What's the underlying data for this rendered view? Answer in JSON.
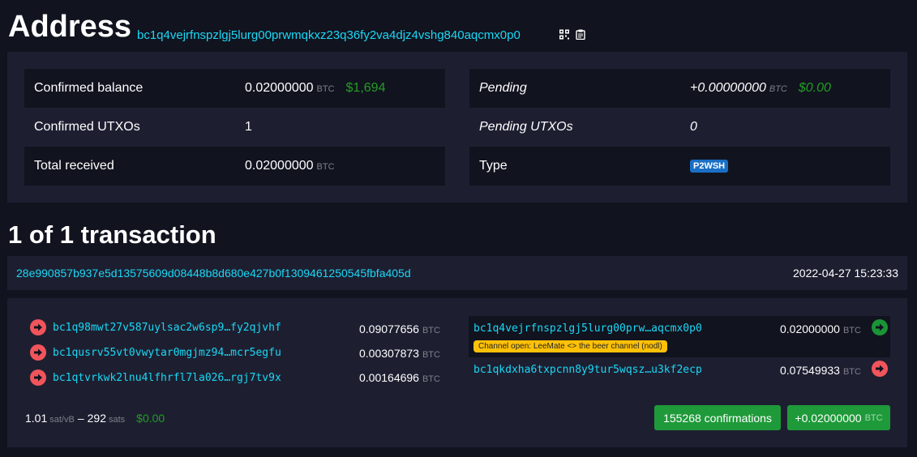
{
  "page": {
    "title": "Address",
    "address": "bc1q4vejrfnspzlgj5lurg00prwmqkxz23q36fy2va4djz4vshg840aqcmx0p0",
    "icons": [
      "qr-code-icon",
      "copy-icon"
    ]
  },
  "summary": {
    "confirmed_balance": {
      "label": "Confirmed balance",
      "amount": "0.02000000",
      "unit": "BTC",
      "fiat": "$1,694"
    },
    "confirmed_utxos": {
      "label": "Confirmed UTXOs",
      "value": "1"
    },
    "total_received": {
      "label": "Total received",
      "amount": "0.02000000",
      "unit": "BTC"
    },
    "pending": {
      "label": "Pending",
      "amount": "+0.00000000",
      "unit": "BTC",
      "fiat": "$0.00"
    },
    "pending_utxos": {
      "label": "Pending UTXOs",
      "value": "0"
    },
    "type": {
      "label": "Type",
      "value": "P2WSH"
    }
  },
  "transactions": {
    "heading": "1 of 1 transaction",
    "items": [
      {
        "txid": "28e990857b937e5d13575609d08448b8d680e427b0f1309461250545fbfa405d",
        "time": "2022-04-27 15:23:33",
        "inputs": [
          {
            "address_start": "bc1q98mwt27v587uylsac2w6sp9…",
            "address_end": "fy2qjvhf",
            "amount": "0.09077656",
            "unit": "BTC"
          },
          {
            "address_start": "bc1qusrv55vt0vwytar0mgjmz94…",
            "address_end": "mcr5egfu",
            "amount": "0.00307873",
            "unit": "BTC"
          },
          {
            "address_start": "bc1qtvrkwk2lnu4lfhrfl7la026…",
            "address_end": "rgj7tv9x",
            "amount": "0.00164696",
            "unit": "BTC"
          }
        ],
        "outputs": [
          {
            "address_start": "bc1q4vejrfnspzlgj5lurg00prw…",
            "address_end": "aqcmx0p0",
            "amount": "0.02000000",
            "unit": "BTC",
            "tag": "Channel open: LeeMate <> the beer channel (nodl)"
          },
          {
            "address_start": "bc1qkdxha6txpcnn8y9tur5wqsz…",
            "address_end": "u3kf2ecp",
            "amount": "0.07549933",
            "unit": "BTC"
          }
        ],
        "fee_rate": "1.01",
        "fee_rate_unit": "sat/vB",
        "fee_separator": "–",
        "fee": "292",
        "fee_unit": "sats",
        "fee_fiat": "$0.00",
        "confirmations": "155268 confirmations",
        "net_change": "+0.02000000",
        "net_unit": "BTC"
      }
    ]
  },
  "colors": {
    "background": "#11131f",
    "panel": "#1d1f31",
    "link": "#1bd8f4",
    "fiat_green": "#239d23",
    "button_green": "#1f9a3a",
    "arrow_red": "#f2545b",
    "arrow_green": "#1a9436",
    "badge_blue": "#1a6fc5",
    "tag_yellow": "#ffc107"
  }
}
